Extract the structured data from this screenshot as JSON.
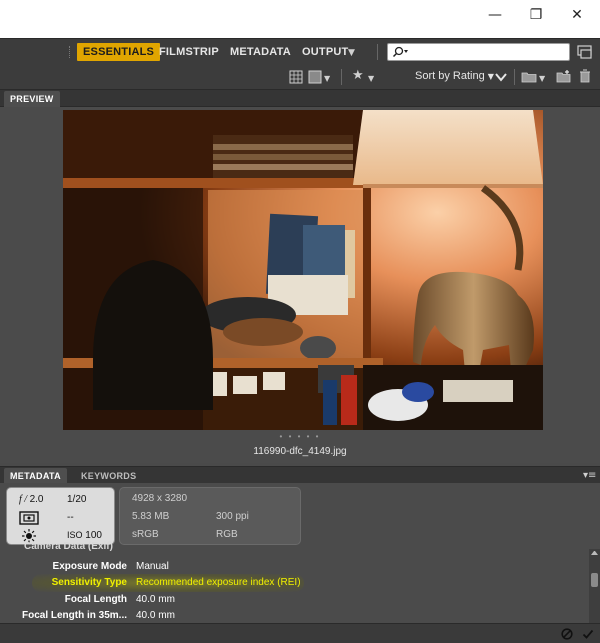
{
  "window": {
    "minimize_glyph": "—",
    "restore_glyph": "❐",
    "close_glyph": "✕"
  },
  "workspaces": {
    "essentials": "ESSENTIALS",
    "filmstrip": "FILMSTRIP",
    "metadata": "METADATA",
    "output": "OUTPUT"
  },
  "toolbar": {
    "sort_label": "Sort by Rating"
  },
  "panels": {
    "preview_tab": "PREVIEW",
    "metadata_tab": "METADATA",
    "keywords_tab": "KEYWORDS"
  },
  "preview": {
    "filename": "116990-dfc_4149.jpg",
    "dots": "• • • • •"
  },
  "exif": {
    "aperture": "2.0",
    "aperture_prefix": "f /",
    "shutter": "1/20",
    "metering_mode": "--",
    "iso_label": "ISO",
    "iso": "100"
  },
  "file_info": {
    "dimensions": "4928 x 3280",
    "file_size": "5.83 MB",
    "resolution": "300 ppi",
    "color_profile": "sRGB",
    "color_mode": "RGB"
  },
  "camera_data": {
    "section_title": "Camera Data (Exif)",
    "rows": [
      {
        "label": "Exposure Mode",
        "value": "Manual"
      },
      {
        "label": "Sensitivity Type",
        "value": "Recommended exposure index (REI)"
      },
      {
        "label": "Focal Length",
        "value": "40.0 mm"
      },
      {
        "label": "Focal Length in 35m...",
        "value": "40.0 mm"
      }
    ],
    "highlight_color": "#e8e800"
  },
  "colors": {
    "workspace_active": "#e0a500",
    "panel_bg": "#4b4b4b"
  }
}
